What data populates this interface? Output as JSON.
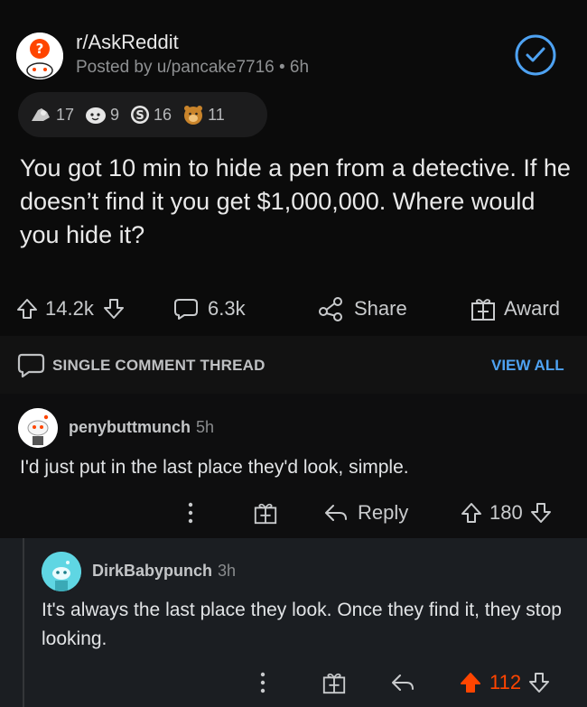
{
  "post": {
    "subreddit": "r/AskReddit",
    "posted_by": "Posted by u/pancake7716 • 6h",
    "awards": [
      {
        "icon": "silver-award-icon",
        "count": "17"
      },
      {
        "icon": "wholesome-award-icon",
        "count": "9"
      },
      {
        "icon": "bravo-award-icon",
        "count": "16"
      },
      {
        "icon": "gold-bear-award-icon",
        "count": "11"
      }
    ],
    "title": "You got 10 min to hide a pen from a detective. If he doesn’t find it you get $1,000,000. Where would you hide it?",
    "upvotes": "14.2k",
    "comments": "6.3k",
    "share_label": "Share",
    "award_label": "Award"
  },
  "thread_bar": {
    "label": "SINGLE COMMENT THREAD",
    "view_all": "VIEW ALL"
  },
  "comments": [
    {
      "username": "penybuttmunch",
      "time": "5h",
      "body": "I'd just put in the last place they'd look, simple.",
      "reply_label": "Reply",
      "score": "180"
    },
    {
      "username": "DirkBabypunch",
      "time": "3h",
      "body": "It's always the last place they look. Once they find it, they stop looking.",
      "score": "112"
    }
  ],
  "colors": {
    "accent_blue": "#4ea2f2",
    "upvote_orange": "#ff4500"
  }
}
